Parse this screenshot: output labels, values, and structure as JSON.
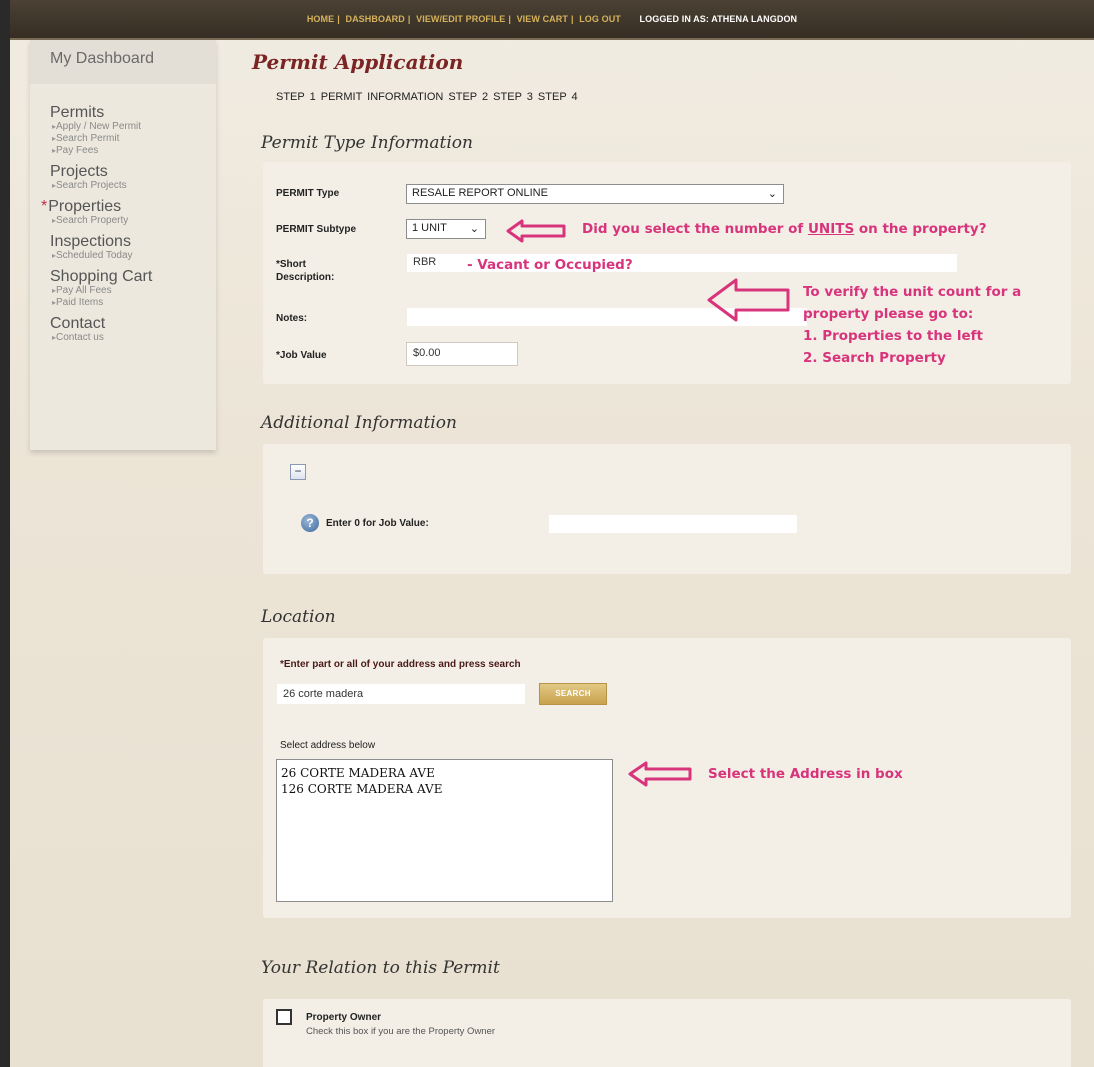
{
  "topnav": {
    "items": [
      "HOME",
      "DASHBOARD",
      "VIEW/EDIT PROFILE",
      "VIEW CART",
      "LOG OUT"
    ],
    "logged_in": "LOGGED IN AS:  ATHENA LANGDON"
  },
  "sidebar": {
    "header": "My Dashboard",
    "groups": [
      {
        "title": "Permits",
        "subs": [
          "Apply / New Permit",
          "Search Permit",
          "Pay Fees"
        ]
      },
      {
        "title": "Projects",
        "subs": [
          "Search Projects"
        ]
      },
      {
        "title": "Properties",
        "subs": [
          "Search Property"
        ]
      },
      {
        "title": "Inspections",
        "subs": [
          "Scheduled Today"
        ]
      },
      {
        "title": "Shopping Cart",
        "subs": [
          "Pay All Fees",
          "Paid Items"
        ]
      },
      {
        "title": "Contact",
        "subs": [
          "Contact us"
        ]
      }
    ]
  },
  "page": {
    "title": "Permit Application",
    "steps": "STEP 1  PERMIT INFORMATION  STEP 2  STEP 3  STEP 4"
  },
  "permit_type": {
    "section_title": "Permit Type Information",
    "type_label": "PERMIT Type",
    "type_value": "RESALE REPORT ONLINE",
    "subtype_label": "PERMIT Subtype",
    "subtype_value": "1 UNIT",
    "short_desc_label_1": "*Short",
    "short_desc_label_2": "Description:",
    "short_desc_value": "RBR",
    "notes_label": "Notes:",
    "job_value_label": "*Job Value",
    "job_value_value": "$0.00"
  },
  "annotations": {
    "units": "Did you select the number of UNITS on the property?",
    "units_pre": "Did you select the number of ",
    "units_u": "UNITS",
    "units_post": " on the property?",
    "vacant": "- Vacant or Occupied?",
    "verify_1": "To verify the unit count for a",
    "verify_2": "property please go to:",
    "verify_3": "1. Properties to the left",
    "verify_4": "2. Search Property",
    "select_address": "Select the Address in box"
  },
  "additional": {
    "section_title": "Additional Information",
    "toggle_symbol": "−",
    "help_symbol": "?",
    "label": "Enter 0 for Job Value:"
  },
  "location": {
    "section_title": "Location",
    "instruction": "*Enter part or all of your address and press search",
    "search_value": "26 corte madera",
    "search_button": "SEARCH",
    "select_label": "Select address below",
    "addresses": [
      "26 CORTE MADERA AVE",
      "126 CORTE MADERA AVE"
    ]
  },
  "relation": {
    "section_title": "Your Relation to this Permit",
    "owner_label": "Property Owner",
    "owner_help": "Check this box if you are the Property Owner"
  },
  "colors": {
    "accent_title": "#7a2424",
    "annotation": "#d8347c",
    "topnav_text": "#d6b25c"
  }
}
